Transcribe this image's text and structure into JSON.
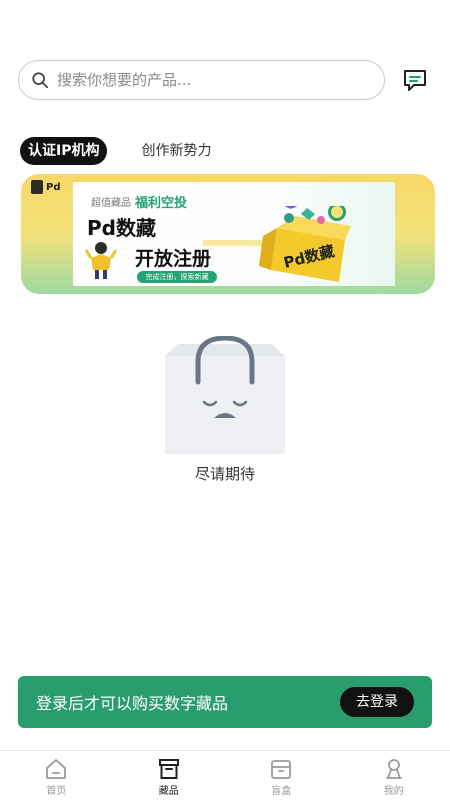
{
  "search": {
    "placeholder": "搜索你想要的产品..."
  },
  "tabs": [
    {
      "label": "认证IP机构",
      "active": true
    },
    {
      "label": "创作新势力",
      "active": false
    }
  ],
  "banner": {
    "logo": "Pd",
    "sub": "超值藏品",
    "fuli": "福利空投",
    "title": "Pd数藏",
    "headline": "开放注册",
    "pill": "完成注册，探索新藏",
    "box_label": "Pd数藏"
  },
  "empty": {
    "text": "尽请期待"
  },
  "login_bar": {
    "message": "登录后才可以购买数字藏品",
    "button": "去登录"
  },
  "tabbar": [
    {
      "label": "首页",
      "icon": "home-icon",
      "active": false
    },
    {
      "label": "藏品",
      "icon": "collection-box-icon",
      "active": true
    },
    {
      "label": "盲盒",
      "icon": "blind-box-icon",
      "active": false
    },
    {
      "label": "我的",
      "icon": "profile-icon",
      "active": false
    }
  ],
  "colors": {
    "accent": "#2a9d6f",
    "dark": "#111111"
  }
}
